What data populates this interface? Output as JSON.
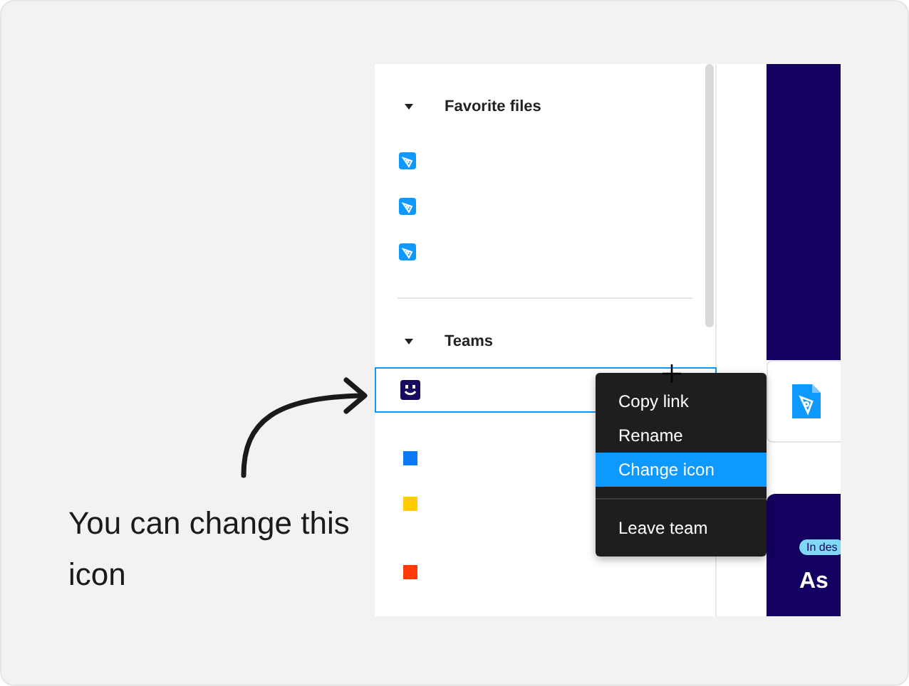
{
  "sidebar": {
    "sections": [
      {
        "title": "Favorite files",
        "expanded": true,
        "items": [
          {
            "kind": "file"
          },
          {
            "kind": "file"
          },
          {
            "kind": "file"
          }
        ]
      },
      {
        "title": "Teams",
        "expanded": true,
        "items": [
          {
            "kind": "avatar",
            "selected": true
          },
          {
            "kind": "gap"
          },
          {
            "kind": "square",
            "color": "#0d7af5",
            "selected": false
          },
          {
            "kind": "square",
            "color": "#ffcc00",
            "selected": false
          },
          {
            "kind": "gap"
          },
          {
            "kind": "square",
            "color": "#ff3b0a",
            "selected": false
          }
        ]
      }
    ]
  },
  "context_menu": {
    "items": [
      {
        "kind": "item",
        "label": "Copy link",
        "selected": false
      },
      {
        "kind": "item",
        "label": "Rename",
        "selected": false
      },
      {
        "kind": "item",
        "label": "Change icon",
        "selected": true
      },
      {
        "kind": "separator"
      },
      {
        "kind": "item",
        "label": "Leave team",
        "selected": false
      }
    ]
  },
  "preview": {
    "badge": "In des",
    "heading": "As"
  },
  "caption": "You can change this icon"
}
